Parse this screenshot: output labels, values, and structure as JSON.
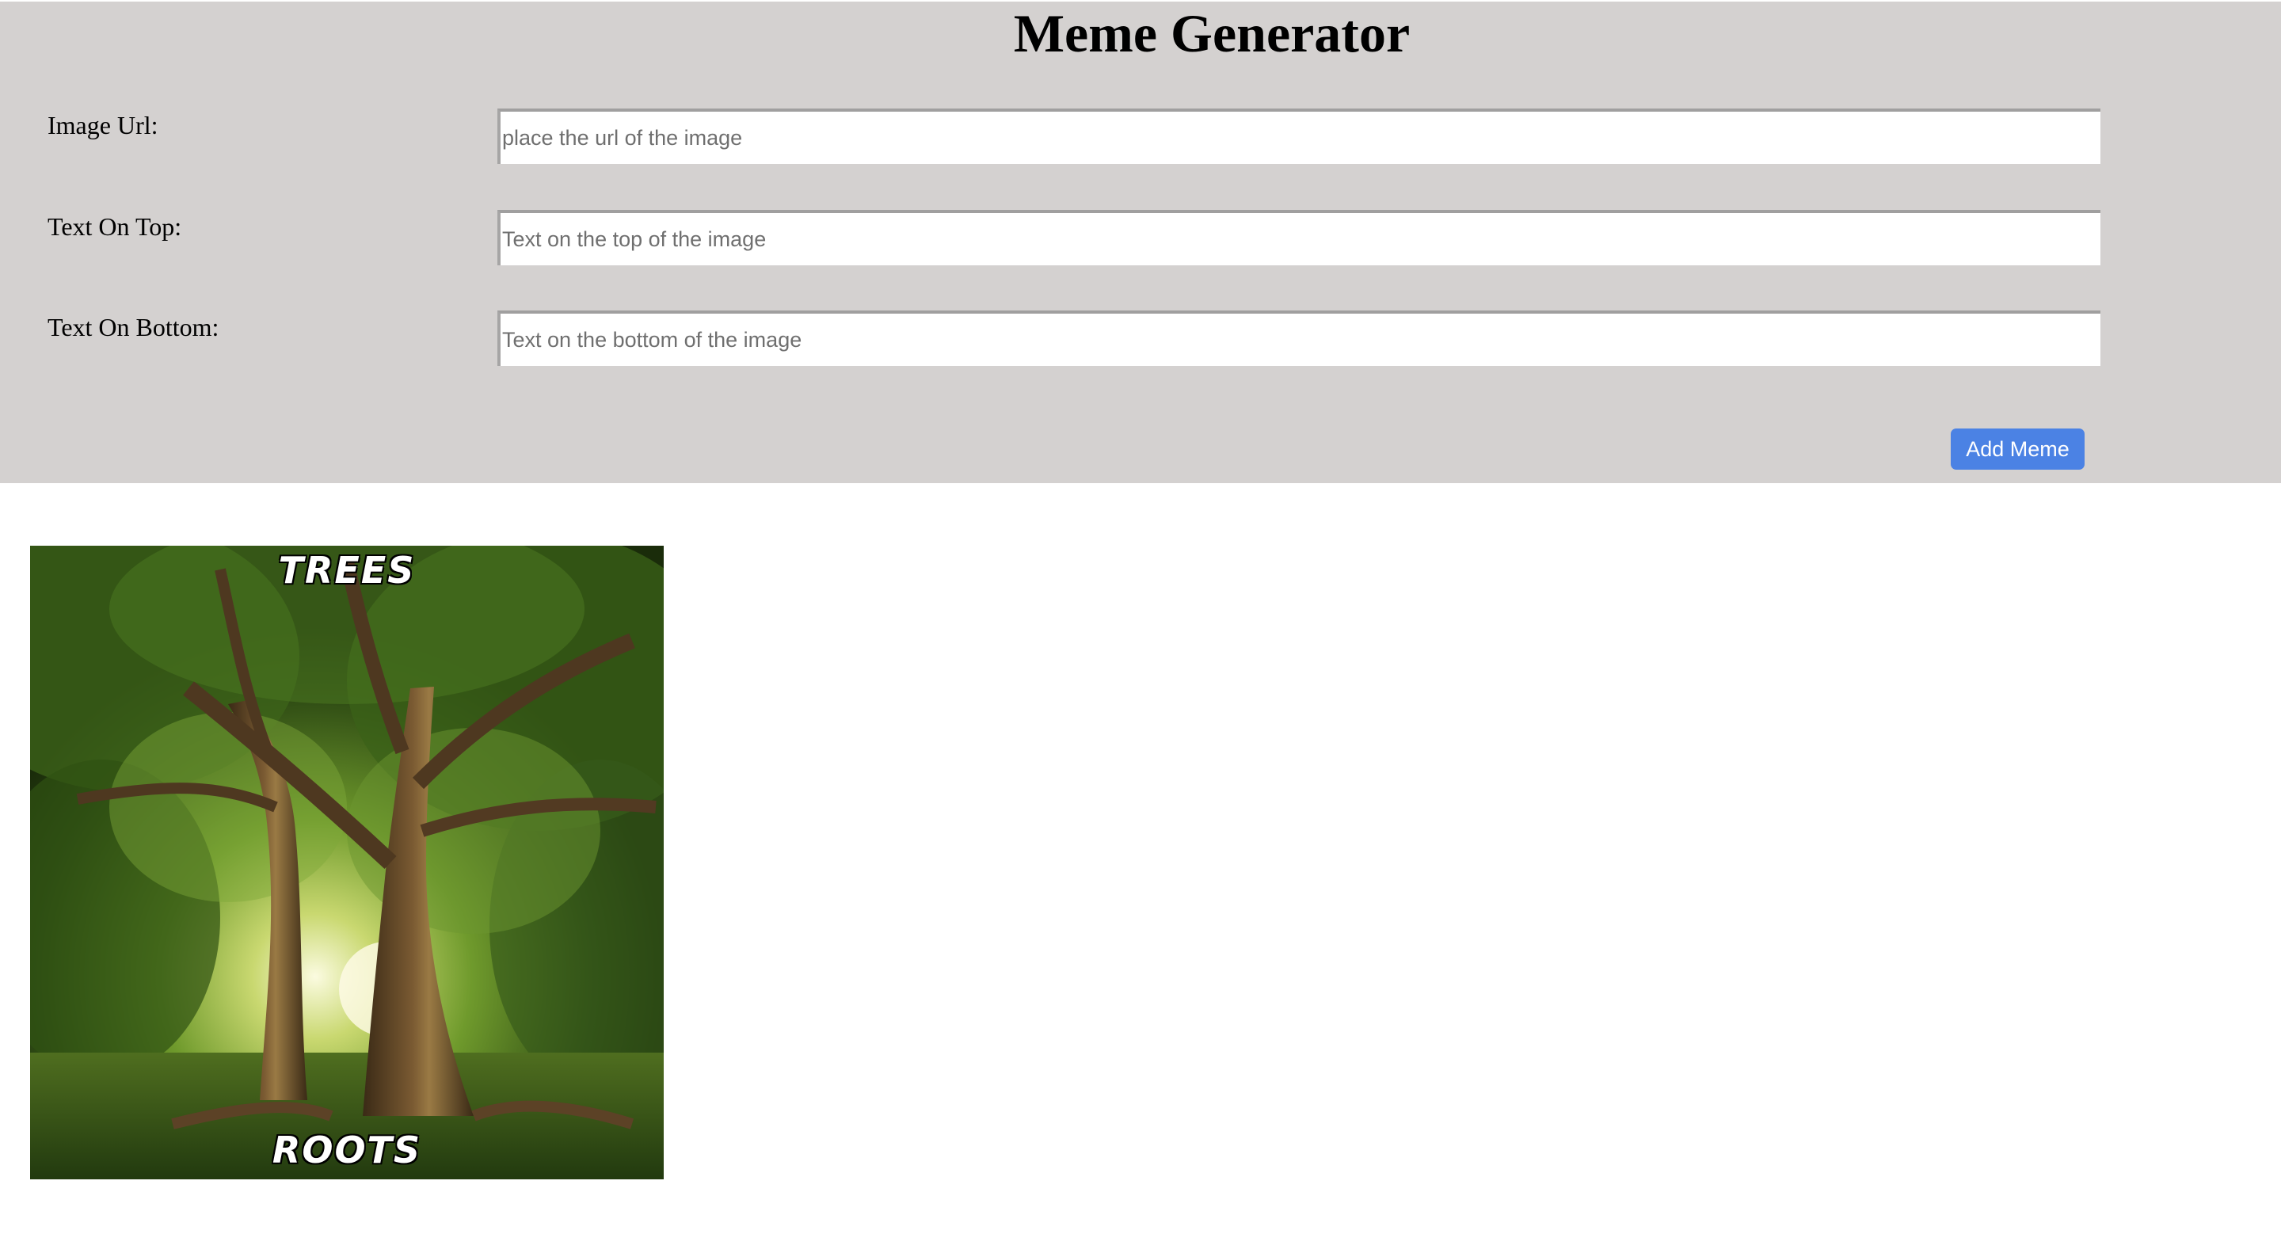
{
  "page": {
    "title": "Meme Generator"
  },
  "form": {
    "image_url": {
      "label": "Image Url:",
      "placeholder": "place the url of the image",
      "value": ""
    },
    "top_text": {
      "label": "Text On Top:",
      "placeholder": "Text on the top of the image",
      "value": ""
    },
    "bottom_text": {
      "label": "Text On Bottom:",
      "placeholder": "Text on the bottom of the image",
      "value": ""
    },
    "submit_label": "Add Meme"
  },
  "memes": [
    {
      "top_text": "TREES",
      "bottom_text": "ROOTS",
      "image_subject": "tree-photo"
    }
  ],
  "colors": {
    "header_background": "#d4d1d0",
    "button_background": "#4b82e4",
    "button_text": "#ffffff"
  }
}
